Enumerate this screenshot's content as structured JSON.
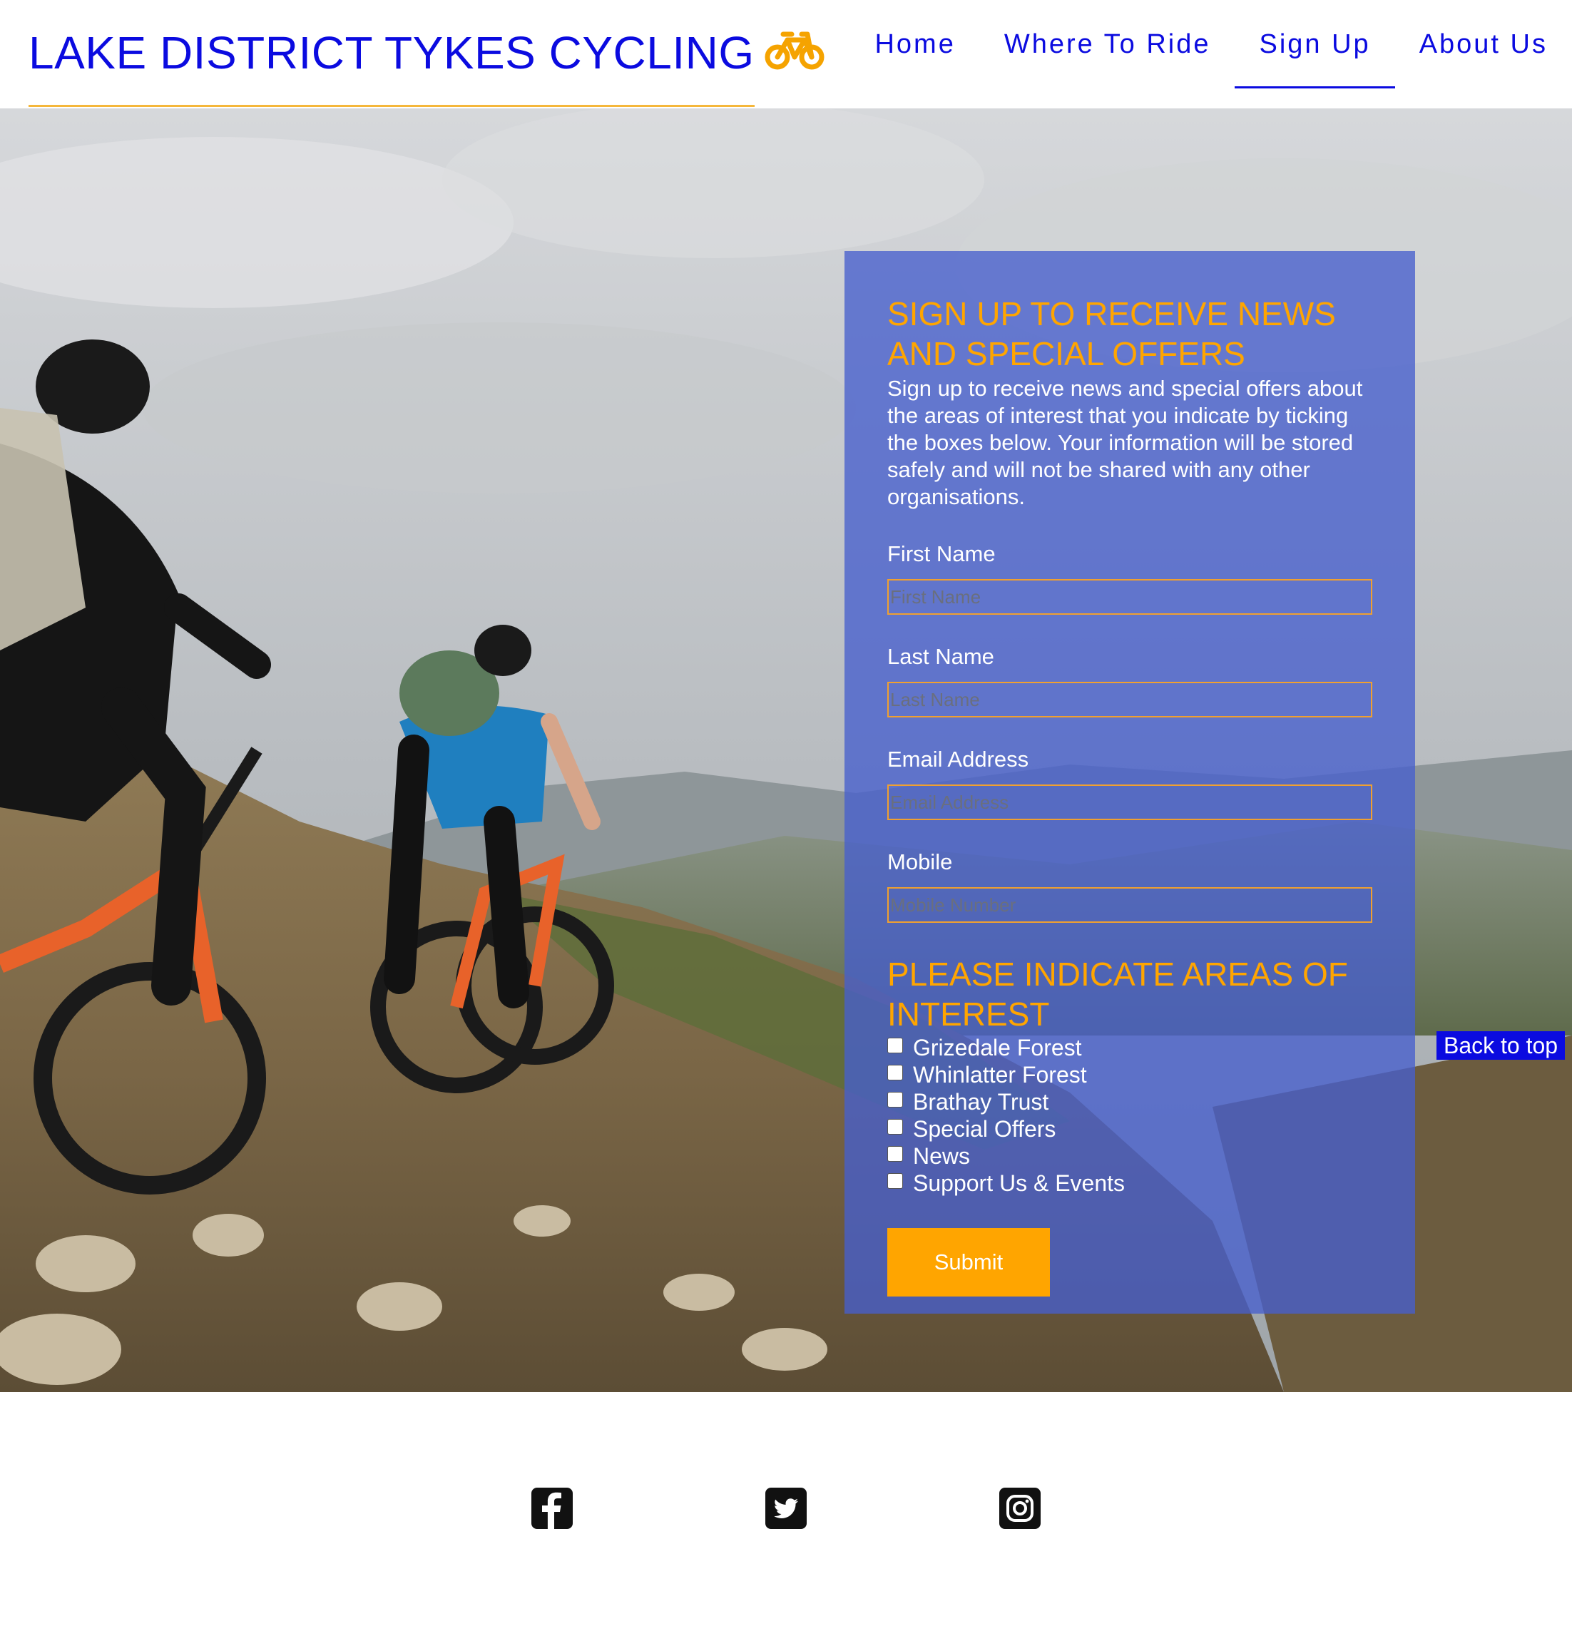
{
  "header": {
    "brand_title": "LAKE DISTRICT TYKES CYCLING",
    "brand_icon": "bicycle-icon",
    "brand_color": "#0b0be0",
    "accent_color": "#ffa500"
  },
  "nav": {
    "items": [
      {
        "label": "Home",
        "active": false
      },
      {
        "label": "Where To Ride",
        "active": false
      },
      {
        "label": "Sign Up",
        "active": true
      },
      {
        "label": "About Us",
        "active": false
      }
    ]
  },
  "form": {
    "heading": "SIGN UP TO RECEIVE NEWS AND SPECIAL OFFERS",
    "intro": "Sign up to receive news and special offers about the areas of interest that you indicate by ticking the boxes below. Your information will be stored safely and will not be shared with any other organisations.",
    "fields": [
      {
        "label": "First Name",
        "placeholder": "First Name",
        "value": ""
      },
      {
        "label": "Last Name",
        "placeholder": "Last Name",
        "value": ""
      },
      {
        "label": "Email Address",
        "placeholder": "Email Address",
        "value": ""
      },
      {
        "label": "Mobile",
        "placeholder": "Mobile Number",
        "value": ""
      }
    ],
    "interest_heading": "PLEASE INDICATE AREAS OF INTEREST",
    "interests": [
      {
        "label": "Grizedale Forest",
        "checked": false
      },
      {
        "label": "Whinlatter Forest",
        "checked": false
      },
      {
        "label": "Brathay Trust",
        "checked": false
      },
      {
        "label": "Special Offers",
        "checked": false
      },
      {
        "label": "News",
        "checked": false
      },
      {
        "label": "Support Us & Events",
        "checked": false
      }
    ],
    "submit_label": "Submit"
  },
  "back_to_top": "Back to top",
  "footer": {
    "social": [
      "facebook-icon",
      "twitter-icon",
      "instagram-icon"
    ]
  }
}
